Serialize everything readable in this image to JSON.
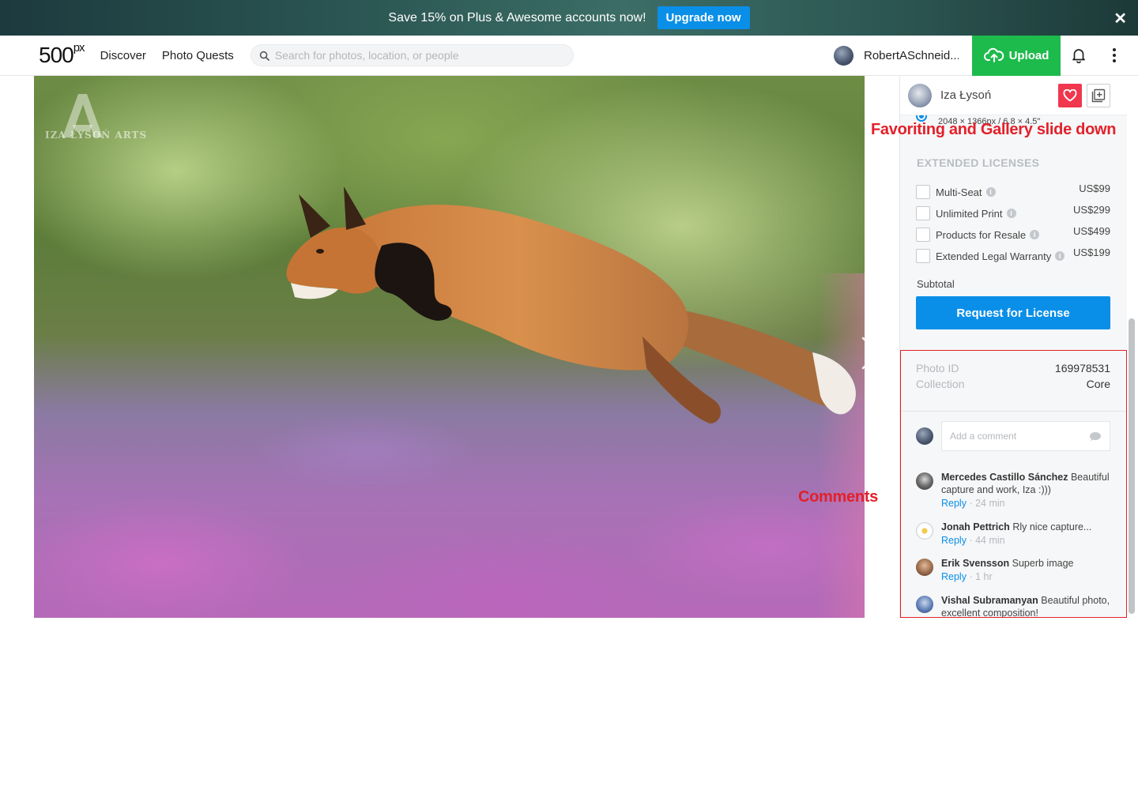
{
  "promo": {
    "text": "Save 15% on Plus & Awesome accounts now!",
    "button": "Upgrade now",
    "close": "✕"
  },
  "nav": {
    "logo": "500",
    "logo_sup": "px",
    "links": [
      "Discover",
      "Photo Quests"
    ],
    "search_placeholder": "Search for photos, location, or people",
    "user_name": "RobertASchneid...",
    "upload": "Upload"
  },
  "photo": {
    "watermark": "IZA ŁYSOŃ ARTS"
  },
  "sidebar": {
    "author": "Iza Łysoń",
    "dimensions": "2048 × 1366px / 6.8 × 4.5\"",
    "extended_title": "EXTENDED LICENSES",
    "licenses": [
      {
        "name": "Multi-Seat",
        "price": "US$99"
      },
      {
        "name": "Unlimited Print",
        "price": "US$299"
      },
      {
        "name": "Products for Resale",
        "price": "US$499"
      },
      {
        "name": "Extended Legal Warranty",
        "price": "US$199"
      }
    ],
    "subtotal": "Subtotal",
    "request_button": "Request for License",
    "meta": [
      {
        "label": "Photo ID",
        "value": "169978531"
      },
      {
        "label": "Collection",
        "value": "Core"
      }
    ],
    "comment_placeholder": "Add a comment",
    "comments": [
      {
        "author": "Mercedes Castillo Sánchez",
        "text": "Beautiful capture and work, Iza :)))",
        "reply": "Reply",
        "time": "· 24 min"
      },
      {
        "author": "Jonah Pettrich",
        "text": "Rly nice capture...",
        "reply": "Reply",
        "time": "· 44 min"
      },
      {
        "author": "Erik Svensson",
        "text": "Superb image",
        "reply": "Reply",
        "time": "· 1 hr"
      },
      {
        "author": "Vishal Subramanyan",
        "text": "Beautiful photo, excellent composition!",
        "reply": "",
        "time": ""
      }
    ]
  },
  "annotations": {
    "favoriting": "Favoriting and Gallery slide down",
    "comments": "Comments"
  },
  "colors": {
    "accent_blue": "#0a8fe8",
    "upload_green": "#1dbb4c",
    "favorite_red": "#f0374d",
    "annotation_red": "#e3202a"
  }
}
